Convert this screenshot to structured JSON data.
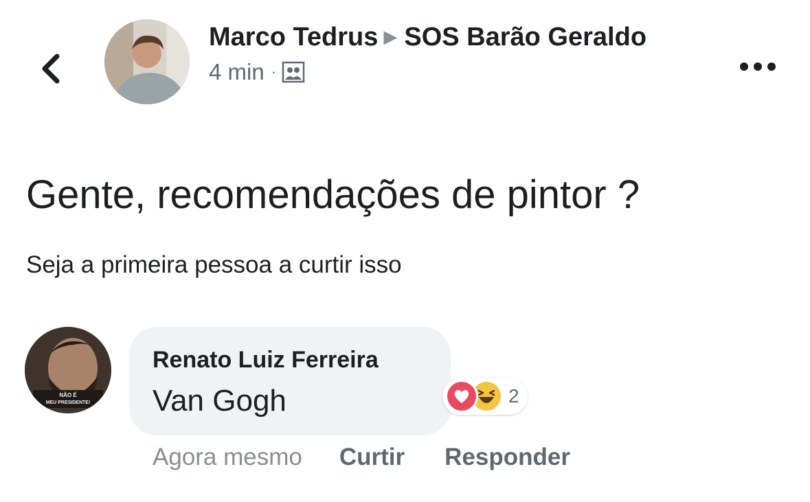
{
  "header": {
    "back_icon": "chevron-left-icon",
    "author": "Marco Tedrus",
    "arrow_icon": "triangle-right-icon",
    "group": "SOS Barão Geraldo",
    "time": "4 min",
    "separator": "·",
    "audience_icon": "group-icon",
    "more_icon": "more-dots-icon"
  },
  "post": {
    "text": "Gente, recomendações de pintor ?",
    "likes_prompt": "Seja a primeira pessoa a curtir isso"
  },
  "comment": {
    "author": "Renato Luiz Ferreira",
    "text": "Van Gogh",
    "avatar_badge_line1": "NÃO É",
    "avatar_badge_line2": "MEU PRESIDENTE!",
    "reactions": {
      "icons": [
        "love-icon",
        "haha-icon"
      ],
      "count": "2"
    },
    "time": "Agora mesmo",
    "like_label": "Curtir",
    "reply_label": "Responder"
  },
  "colors": {
    "text": "#1c1e21",
    "secondary": "#606770",
    "bubble": "#f0f2f5",
    "love": "#e84a62",
    "haha": "#f4c542"
  }
}
